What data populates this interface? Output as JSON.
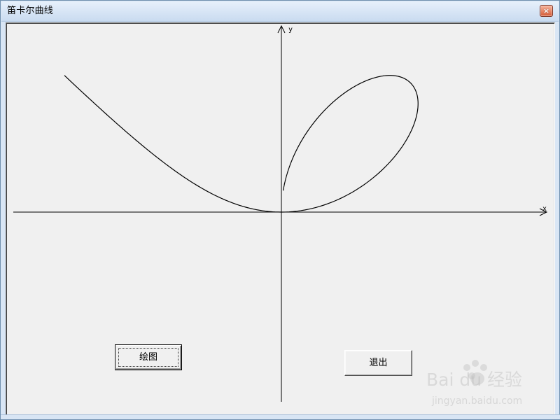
{
  "window": {
    "title": "笛卡尔曲线",
    "close_glyph": "×"
  },
  "plot": {
    "x_axis_label": "x",
    "y_axis_label": "y",
    "curve_name": "",
    "folium_a": 3,
    "line_color": "#000000",
    "background_color": "#f0f0f0"
  },
  "buttons": {
    "draw_label": "绘图",
    "exit_label": "退出"
  },
  "watermark": {
    "brand": "Bai du 经验",
    "url": "jingyan.baidu.com"
  }
}
